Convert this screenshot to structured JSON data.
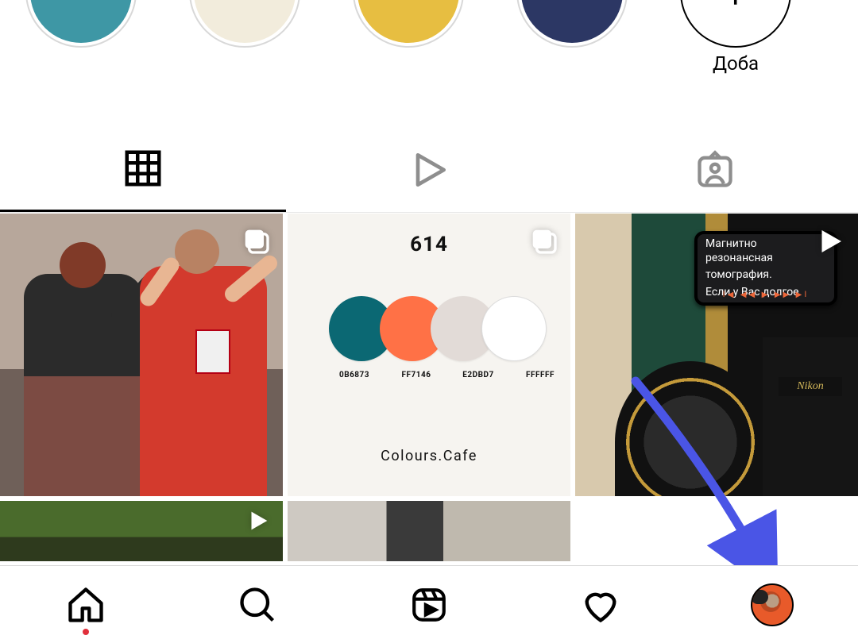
{
  "highlights": {
    "items": [
      {
        "color": "#3e97a5"
      },
      {
        "color": "#f2ecdc"
      },
      {
        "color": "#e7be41"
      },
      {
        "color": "#2c3764"
      }
    ],
    "add_label": "Доба"
  },
  "tabs": {
    "grid": "posts-grid",
    "reels": "reels",
    "tagged": "tagged"
  },
  "posts": [
    {
      "type": "carousel"
    },
    {
      "type": "carousel",
      "palette_number": "614",
      "swatches": [
        {
          "hex": "0B6873",
          "color": "#0b6873"
        },
        {
          "hex": "FF7146",
          "color": "#ff7146"
        },
        {
          "hex": "E2DBD7",
          "color": "#e2dbd7"
        },
        {
          "hex": "FFFFFF",
          "color": "#ffffff"
        }
      ],
      "brand": "Colours.Cafe"
    },
    {
      "type": "video",
      "phone_text_l1": "Магнитно резонансная",
      "phone_text_l2": "томография.",
      "phone_text_l3": "Если у Вас долгое",
      "camera_brand": "Nikon"
    },
    {
      "type": "video"
    },
    {
      "type": "image"
    },
    {
      "type": "image"
    }
  ],
  "nav": {
    "home": "home",
    "search": "search",
    "reels": "reels",
    "activity": "activity",
    "profile": "profile"
  }
}
